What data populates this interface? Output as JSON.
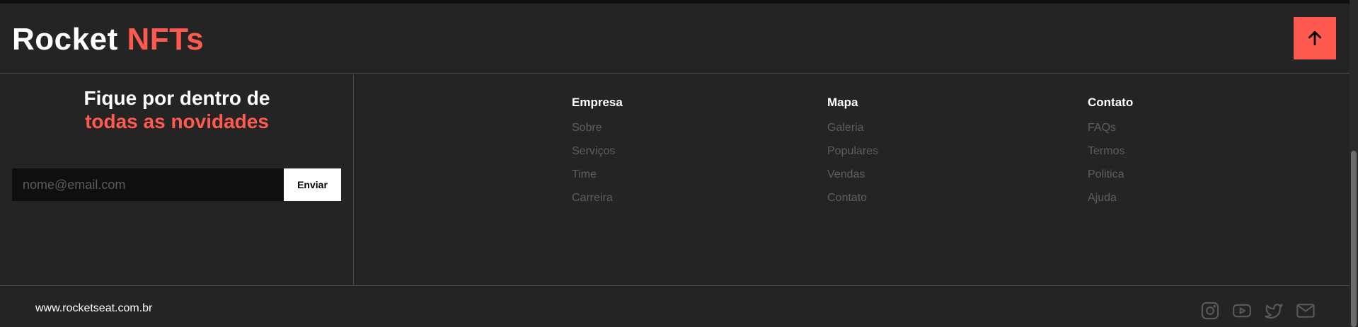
{
  "brand": {
    "name_part1": "Rocket",
    "name_part2": "NFTs",
    "accent_color": "#ff5a50"
  },
  "header": {
    "to_top_icon": "arrow-up-icon"
  },
  "newsletter": {
    "title_line1": "Fique por dentro de",
    "title_line2": "todas as novidades",
    "input_placeholder": "nome@email.com",
    "button_label": "Enviar"
  },
  "columns": [
    {
      "title": "Empresa",
      "items": [
        "Sobre",
        "Serviços",
        "Time",
        "Carreira"
      ]
    },
    {
      "title": "Mapa",
      "items": [
        "Galeria",
        "Populares",
        "Vendas",
        "Contato"
      ]
    },
    {
      "title": "Contato",
      "items": [
        "FAQs",
        "Termos",
        "Politica",
        "Ajuda"
      ]
    }
  ],
  "footer": {
    "site_url": "www.rocketseat.com.br",
    "social_icons": [
      "instagram-icon",
      "youtube-icon",
      "twitter-icon",
      "mail-icon"
    ]
  }
}
